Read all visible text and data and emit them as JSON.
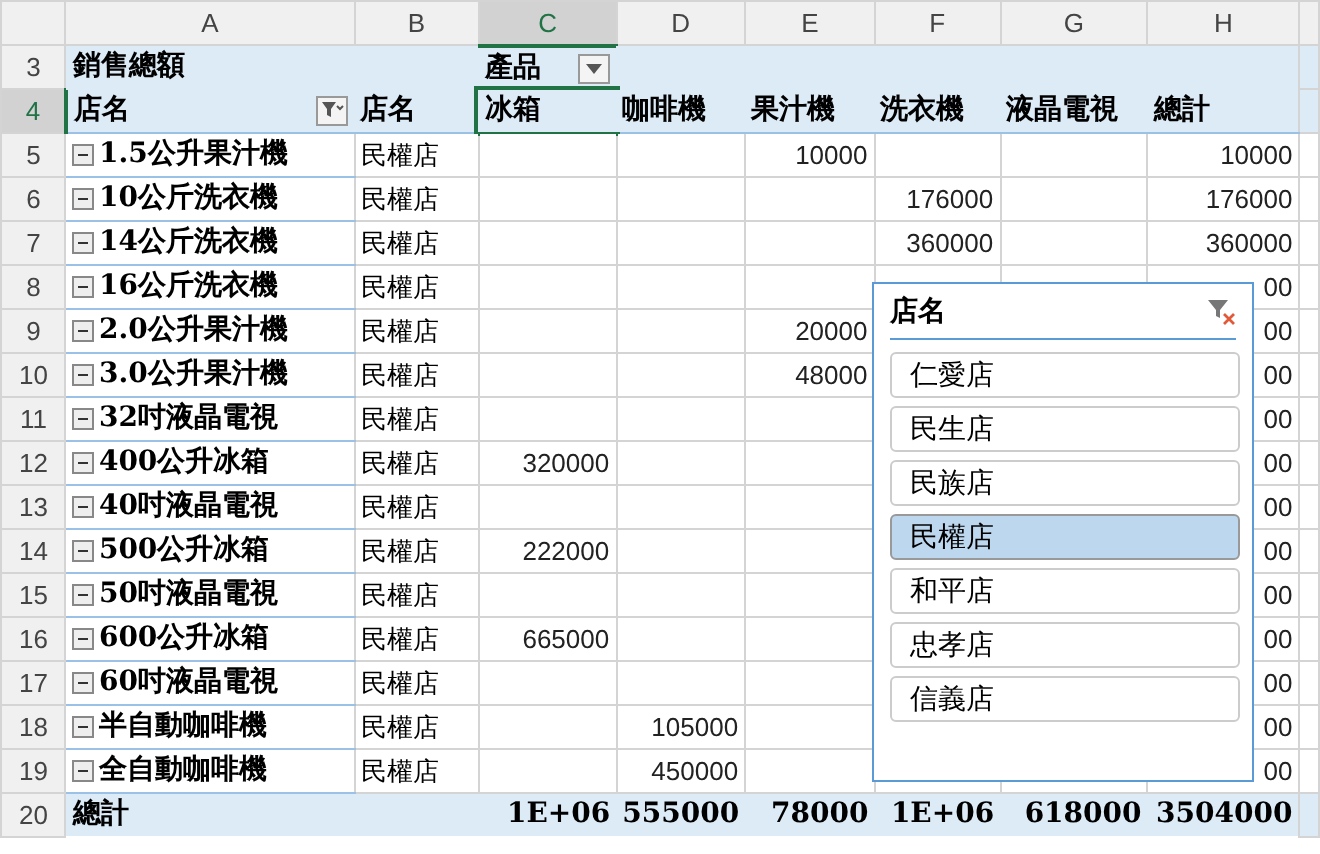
{
  "column_headers": [
    {
      "label": "A",
      "selected": false
    },
    {
      "label": "B",
      "selected": false
    },
    {
      "label": "C",
      "selected": true
    },
    {
      "label": "D",
      "selected": false
    },
    {
      "label": "E",
      "selected": false
    },
    {
      "label": "F",
      "selected": false
    },
    {
      "label": "G",
      "selected": false
    },
    {
      "label": "H",
      "selected": false
    }
  ],
  "rows": [
    {
      "number": "3",
      "kind": "header",
      "selected": false,
      "cells": [
        {
          "text": "銷售總額"
        },
        null,
        {
          "text": "產品",
          "dropdown": true
        },
        null,
        null,
        null,
        null,
        null
      ]
    },
    {
      "number": "4",
      "kind": "header",
      "selected": true,
      "cells": [
        {
          "text": "店名",
          "filter": true
        },
        {
          "text": "店名"
        },
        {
          "text": "冰箱"
        },
        {
          "text": "咖啡機"
        },
        {
          "text": "果汁機"
        },
        {
          "text": "洗衣機"
        },
        {
          "text": "液晶電視"
        },
        {
          "text": "總計"
        }
      ]
    },
    {
      "number": "5",
      "kind": "item",
      "selected": false,
      "cells": [
        {
          "text": "1.5公升果汁機",
          "collapse": true
        },
        {
          "text": "民權店"
        },
        null,
        null,
        {
          "text": "10000"
        },
        null,
        null,
        {
          "text": "10000"
        }
      ]
    },
    {
      "number": "6",
      "kind": "item",
      "selected": false,
      "cells": [
        {
          "text": "10公斤洗衣機",
          "collapse": true
        },
        {
          "text": "民權店"
        },
        null,
        null,
        null,
        {
          "text": "176000"
        },
        null,
        {
          "text": "176000"
        }
      ]
    },
    {
      "number": "7",
      "kind": "item",
      "selected": false,
      "cells": [
        {
          "text": "14公斤洗衣機",
          "collapse": true
        },
        {
          "text": "民權店"
        },
        null,
        null,
        null,
        {
          "text": "360000"
        },
        null,
        {
          "text": "360000"
        }
      ]
    },
    {
      "number": "8",
      "kind": "item",
      "selected": false,
      "cells": [
        {
          "text": "16公斤洗衣機",
          "collapse": true
        },
        {
          "text": "民權店"
        },
        null,
        null,
        null,
        null,
        null,
        {
          "text": "00"
        }
      ]
    },
    {
      "number": "9",
      "kind": "item",
      "selected": false,
      "cells": [
        {
          "text": "2.0公升果汁機",
          "collapse": true
        },
        {
          "text": "民權店"
        },
        null,
        null,
        {
          "text": "20000"
        },
        null,
        null,
        {
          "text": "00"
        }
      ]
    },
    {
      "number": "10",
      "kind": "item",
      "selected": false,
      "cells": [
        {
          "text": "3.0公升果汁機",
          "collapse": true
        },
        {
          "text": "民權店"
        },
        null,
        null,
        {
          "text": "48000"
        },
        null,
        null,
        {
          "text": "00"
        }
      ]
    },
    {
      "number": "11",
      "kind": "item",
      "selected": false,
      "cells": [
        {
          "text": "32吋液晶電視",
          "collapse": true
        },
        {
          "text": "民權店"
        },
        null,
        null,
        null,
        null,
        null,
        {
          "text": "00"
        }
      ]
    },
    {
      "number": "12",
      "kind": "item",
      "selected": false,
      "cells": [
        {
          "text": "400公升冰箱",
          "collapse": true
        },
        {
          "text": "民權店"
        },
        {
          "text": "320000"
        },
        null,
        null,
        null,
        null,
        {
          "text": "00"
        }
      ]
    },
    {
      "number": "13",
      "kind": "item",
      "selected": false,
      "cells": [
        {
          "text": "40吋液晶電視",
          "collapse": true
        },
        {
          "text": "民權店"
        },
        null,
        null,
        null,
        null,
        null,
        {
          "text": "00"
        }
      ]
    },
    {
      "number": "14",
      "kind": "item",
      "selected": false,
      "cells": [
        {
          "text": "500公升冰箱",
          "collapse": true
        },
        {
          "text": "民權店"
        },
        {
          "text": "222000"
        },
        null,
        null,
        null,
        null,
        {
          "text": "00"
        }
      ]
    },
    {
      "number": "15",
      "kind": "item",
      "selected": false,
      "cells": [
        {
          "text": "50吋液晶電視",
          "collapse": true
        },
        {
          "text": "民權店"
        },
        null,
        null,
        null,
        null,
        null,
        {
          "text": "00"
        }
      ]
    },
    {
      "number": "16",
      "kind": "item",
      "selected": false,
      "cells": [
        {
          "text": "600公升冰箱",
          "collapse": true
        },
        {
          "text": "民權店"
        },
        {
          "text": "665000"
        },
        null,
        null,
        null,
        null,
        {
          "text": "00"
        }
      ]
    },
    {
      "number": "17",
      "kind": "item",
      "selected": false,
      "cells": [
        {
          "text": "60吋液晶電視",
          "collapse": true
        },
        {
          "text": "民權店"
        },
        null,
        null,
        null,
        null,
        null,
        {
          "text": "00"
        }
      ]
    },
    {
      "number": "18",
      "kind": "item",
      "selected": false,
      "cells": [
        {
          "text": "半自動咖啡機",
          "collapse": true
        },
        {
          "text": "民權店"
        },
        null,
        {
          "text": "105000"
        },
        null,
        null,
        null,
        {
          "text": "00"
        }
      ]
    },
    {
      "number": "19",
      "kind": "item",
      "selected": false,
      "cells": [
        {
          "text": "全自動咖啡機",
          "collapse": true
        },
        {
          "text": "民權店"
        },
        null,
        {
          "text": "450000"
        },
        null,
        null,
        null,
        {
          "text": "00"
        }
      ]
    },
    {
      "number": "20",
      "kind": "total",
      "selected": false,
      "cells": [
        {
          "text": "總計"
        },
        null,
        {
          "text": "1E+06"
        },
        {
          "text": "555000"
        },
        {
          "text": "78000"
        },
        {
          "text": "1E+06"
        },
        {
          "text": "618000"
        },
        {
          "text": "3504000"
        }
      ]
    }
  ],
  "slicer": {
    "title": "店名",
    "items": [
      {
        "label": "仁愛店",
        "selected": false
      },
      {
        "label": "民生店",
        "selected": false
      },
      {
        "label": "民族店",
        "selected": false
      },
      {
        "label": "民權店",
        "selected": true
      },
      {
        "label": "和平店",
        "selected": false
      },
      {
        "label": "忠孝店",
        "selected": false
      },
      {
        "label": "信義店",
        "selected": false
      }
    ]
  }
}
